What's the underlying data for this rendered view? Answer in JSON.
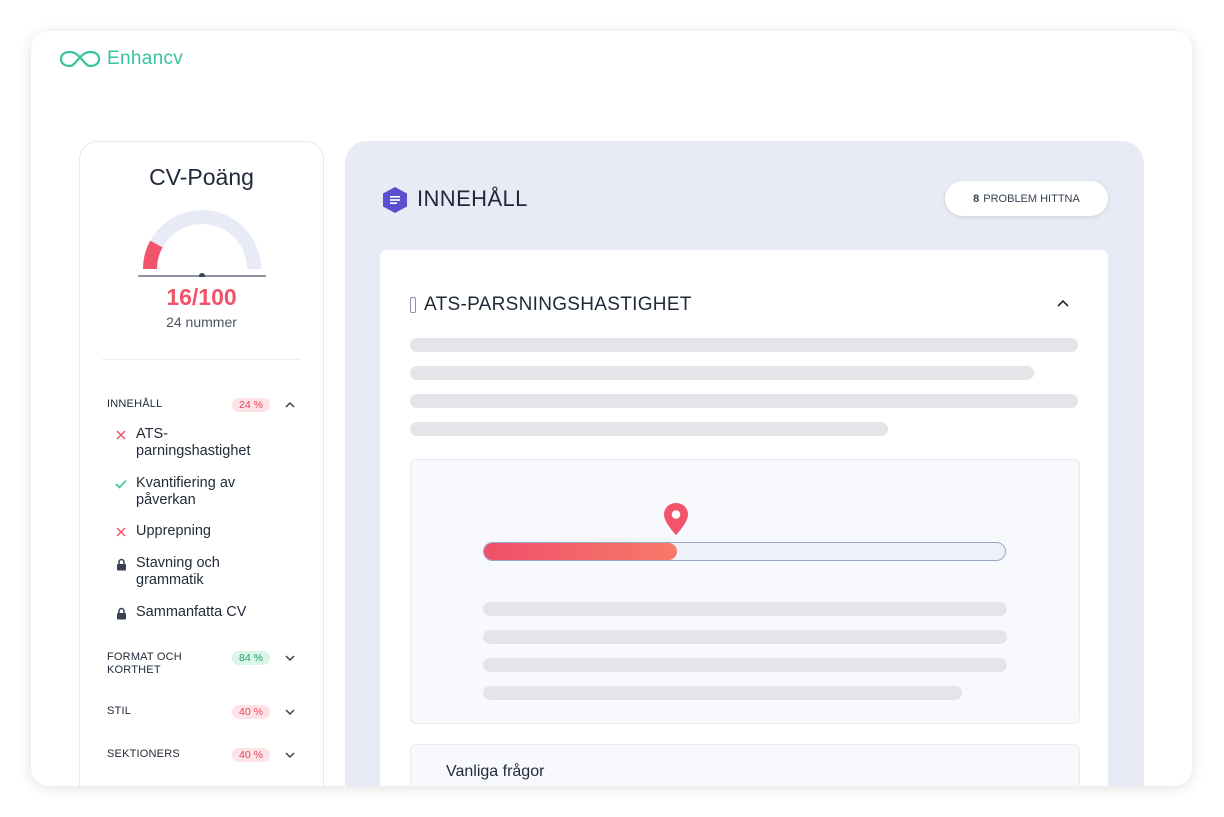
{
  "app": {
    "logo_text": "Enhancv"
  },
  "score": {
    "title": "CV-Poäng",
    "value": "16/100",
    "fraction": 0.16,
    "subtitle": "24 nummer"
  },
  "sections": [
    {
      "label": "INNEHÅLL",
      "badge": "24 %",
      "badge_color": "#f2546c",
      "expanded": true,
      "items": [
        {
          "label": "ATS-parningshastighet",
          "status": "fail",
          "icon": "x-icon"
        },
        {
          "label": "Kvantifiering av påverkan",
          "status": "pass",
          "icon": "check-icon"
        },
        {
          "label": "Upprepning",
          "status": "fail",
          "icon": "x-icon"
        },
        {
          "label": "Stavning och grammatik",
          "status": "locked",
          "icon": "lock-icon"
        },
        {
          "label": "Sammanfatta CV",
          "status": "locked",
          "icon": "lock-icon"
        }
      ]
    },
    {
      "label": "FORMAT OCH KORTHET",
      "badge": "84 %",
      "badge_color": "#1f9c6b",
      "expanded": false
    },
    {
      "label": "STIL",
      "badge": "40 %",
      "badge_color": "#f2546c",
      "expanded": false
    },
    {
      "label": "SEKTIONERS",
      "badge": "40 %",
      "badge_color": "#f2546c",
      "expanded": false
    }
  ],
  "panel": {
    "title": "INNEHÅLL",
    "icon": "document-hex-icon",
    "problems_count": "8",
    "problems_text": "PROBLEM HITTNA",
    "card": {
      "title": "ATS-PARSNINGSHASTIGHET",
      "meter_fraction": 0.37,
      "faq_label": "Vanliga frågor"
    }
  },
  "colors": {
    "accent_red": "#f2546c",
    "accent_green": "#37c3a0",
    "panel_bg": "#e8ebf6",
    "hex_icon": "#5a4fcf"
  }
}
